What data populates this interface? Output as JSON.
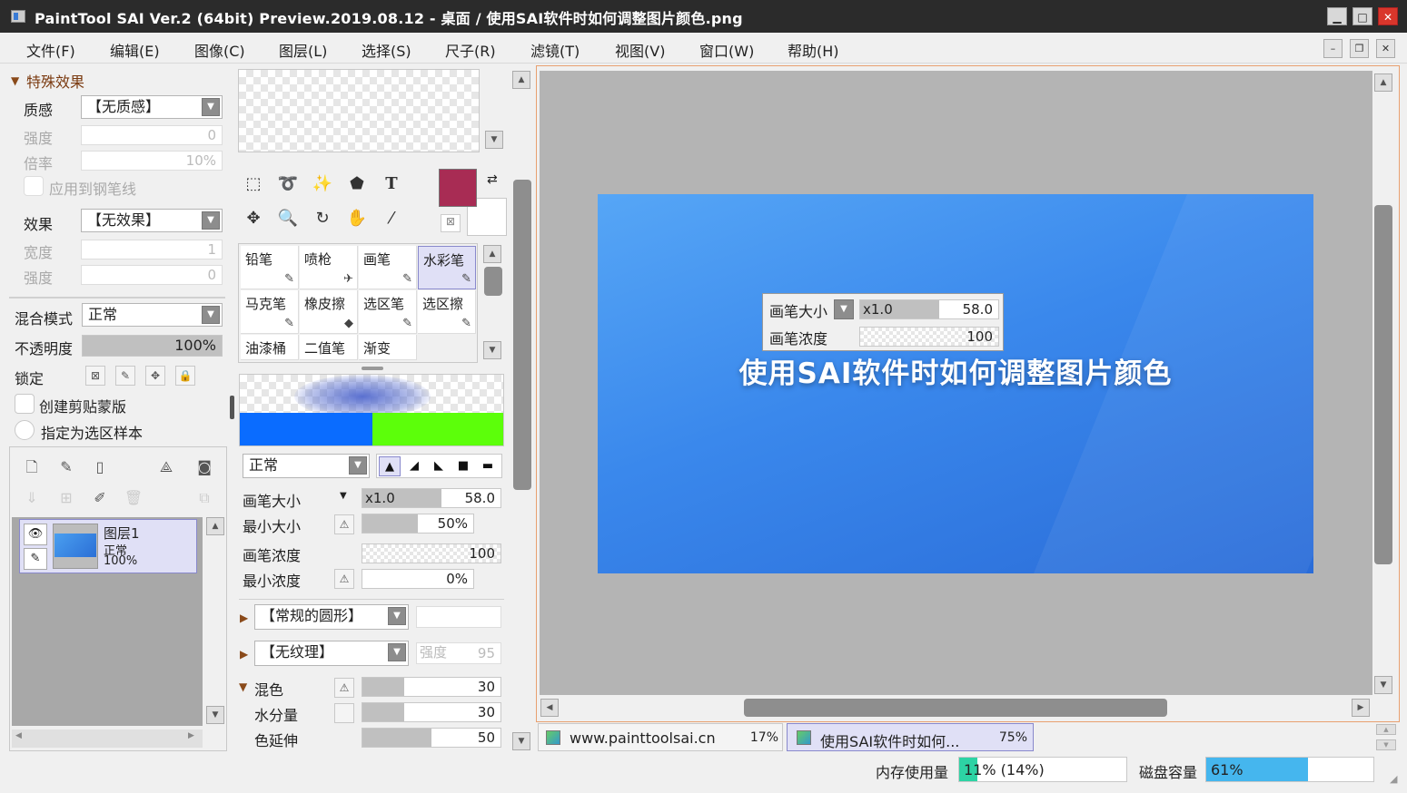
{
  "window": {
    "title": "PaintTool SAI Ver.2 (64bit) Preview.2019.08.12 - 桌面 / 使用SAI软件时如何调整图片颜色.png",
    "min": "▁",
    "max": "□",
    "close": "✕"
  },
  "menu": [
    "文件(F)",
    "编辑(E)",
    "图像(C)",
    "图层(L)",
    "选择(S)",
    "尺子(R)",
    "滤镜(T)",
    "视图(V)",
    "窗口(W)",
    "帮助(H)"
  ],
  "mdi": {
    "min": "–",
    "restore": "❐",
    "close": "✕"
  },
  "effects": {
    "section": "特殊效果",
    "texture_label": "质感",
    "texture_value": "【无质感】",
    "strength_label": "强度",
    "strength_value": "0",
    "scale_label": "倍率",
    "scale_value": "10%",
    "apply_pen": "应用到钢笔线",
    "effect_label": "效果",
    "effect_value": "【无效果】",
    "width_label": "宽度",
    "width_value": "1",
    "strength2_label": "强度",
    "strength2_value": "0"
  },
  "layer_props": {
    "blend_label": "混合模式",
    "blend_value": "正常",
    "opacity_label": "不透明度",
    "opacity_value": "100%",
    "lock_label": "锁定",
    "clip_label": "创建剪贴蒙版",
    "sample_label": "指定为选区样本"
  },
  "layer": {
    "name": "图层1",
    "mode": "正常",
    "opacity": "100%"
  },
  "colors": {
    "primary": "#a82c54",
    "secondary": "#ffffff",
    "accent": "#3a7bd5"
  },
  "brushes": [
    {
      "name": "铅笔",
      "icon": "✎"
    },
    {
      "name": "喷枪",
      "icon": "✈"
    },
    {
      "name": "画笔",
      "icon": "✎"
    },
    {
      "name": "水彩笔",
      "icon": "✎"
    },
    {
      "name": "马克笔",
      "icon": "✎"
    },
    {
      "name": "橡皮擦",
      "icon": "◆"
    },
    {
      "name": "选区笔",
      "icon": "✎"
    },
    {
      "name": "选区擦",
      "icon": "✎"
    },
    {
      "name": "油漆桶",
      "icon": ""
    },
    {
      "name": "二值笔",
      "icon": ""
    },
    {
      "name": "渐变",
      "icon": ""
    }
  ],
  "brush_settings": {
    "mode": "正常",
    "size_label": "画笔大小",
    "size_mult": "x1.0",
    "size_value": "58.0",
    "min_size_label": "最小大小",
    "min_size_value": "50%",
    "density_label": "画笔浓度",
    "density_value": "100",
    "min_density_label": "最小浓度",
    "min_density_value": "0%",
    "shape_value": "【常规的圆形】",
    "texture_value": "【无纹理】",
    "tex_strength_label": "强度",
    "tex_strength_value": "95",
    "mix_label": "混色",
    "mix_value": "30",
    "water_label": "水分量",
    "water_value": "30",
    "extend_label": "色延伸",
    "extend_value": "50"
  },
  "canvas": {
    "image_title": "使用SAI软件时如何调整图片颜色",
    "overlay_size_label": "画笔大小",
    "overlay_size_mult": "x1.0",
    "overlay_size_value": "58.0",
    "overlay_density_label": "画笔浓度",
    "overlay_density_value": "100"
  },
  "doc_tabs": [
    {
      "name": "www.painttoolsai.cn",
      "zoom": "17%"
    },
    {
      "name": "使用SAI软件时如何...",
      "zoom": "75%"
    }
  ],
  "status": {
    "memory_label": "内存使用量",
    "memory_value": "11% (14%)",
    "memory_fraction": 0.11,
    "disk_label": "磁盘容量",
    "disk_value": "61%",
    "disk_fraction": 0.61
  }
}
